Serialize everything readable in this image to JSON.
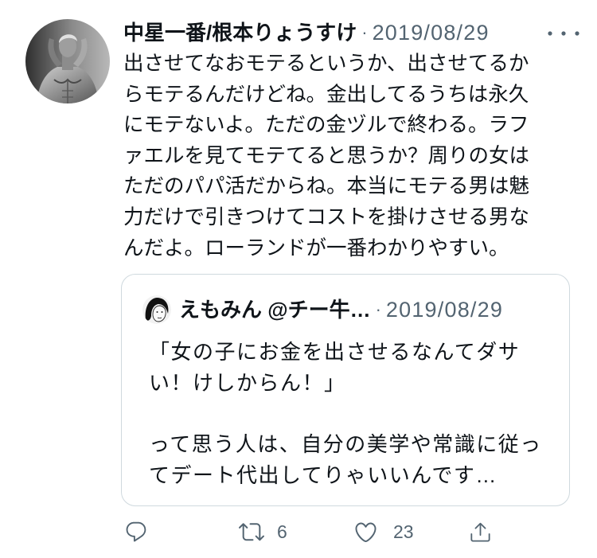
{
  "colors": {
    "text": "#0f1419",
    "secondary": "#536471",
    "border": "#cfd9de",
    "background": "#ffffff"
  },
  "tweet": {
    "avatar_icon": "profile-photo",
    "author_name": "中星一番/根本りょうすけ",
    "separator": "·",
    "date": "2019/08/29",
    "more_icon": "more-dots-icon",
    "lines": [
      "出させてなおモテるというか、出させてるか",
      "らモテるんだけどね。金出してるうちは永久",
      "にモテないよ。ただの金ヅルで終わる。ラフ",
      "ァエルを見てモテてると思うか？周りの女は",
      "ただのパパ活だからね。本当にモテる男は魅",
      "力だけで引きつけてコストを掛けさせる男な",
      "んだよ。ローランドが一番わかりやすい。"
    ]
  },
  "quote": {
    "avatar_icon": "illustrated-avatar",
    "author_name": "えもみん @チー牛…",
    "separator": "·",
    "date": "2019/08/29",
    "paragraphs": [
      [
        "「女の子にお金を出させるなんてダサ",
        "い！けしからん！」"
      ],
      [
        "って思う人は、自分の美学や常識に従っ",
        "てデート代出してりゃいいんです…"
      ]
    ]
  },
  "actions": {
    "reply": {
      "icon": "reply-icon"
    },
    "retweet": {
      "icon": "retweet-icon",
      "count": "6"
    },
    "like": {
      "icon": "heart-icon",
      "count": "23"
    },
    "share": {
      "icon": "share-icon"
    }
  }
}
